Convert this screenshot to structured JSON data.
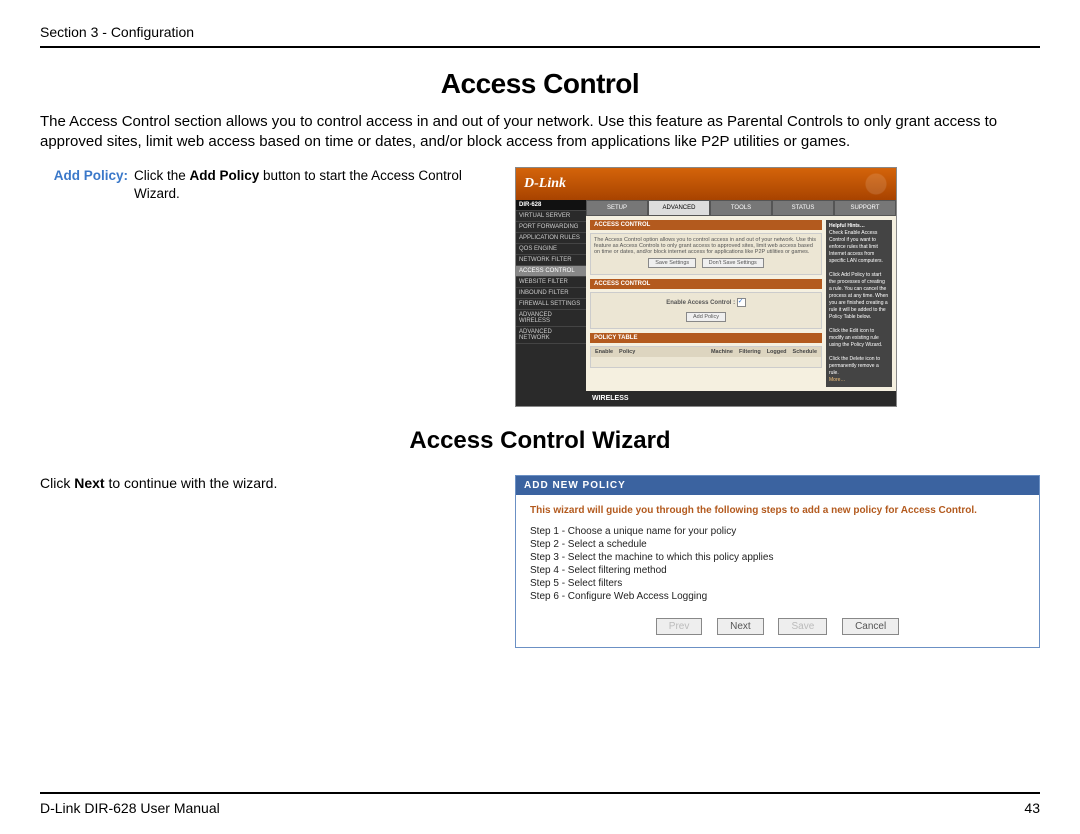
{
  "header": "Section 3 - Configuration",
  "title": "Access Control",
  "intro": "The Access Control section allows you to control access in and out of your network. Use this feature as Parental Controls to only grant access to approved sites, limit web access based on time or dates, and/or block access from applications like P2P utilities or games.",
  "feature": {
    "label": "Add Policy:",
    "text_before": "Click the ",
    "text_bold": "Add Policy",
    "text_after": " button to start the Access Control Wizard."
  },
  "screenshot1": {
    "brand": "D-Link",
    "model": "DIR-628",
    "tabs": [
      "SETUP",
      "ADVANCED",
      "TOOLS",
      "STATUS",
      "SUPPORT"
    ],
    "active_tab": 1,
    "sidebar": [
      "VIRTUAL SERVER",
      "PORT FORWARDING",
      "APPLICATION RULES",
      "QOS ENGINE",
      "NETWORK FILTER",
      "ACCESS CONTROL",
      "WEBSITE FILTER",
      "INBOUND FILTER",
      "FIREWALL SETTINGS",
      "ADVANCED WIRELESS",
      "ADVANCED NETWORK"
    ],
    "active_sidebar": 5,
    "section_title": "ACCESS CONTROL",
    "section_desc": "The Access Control option allows you to control access in and out of your network. Use this feature as Access Controls to only grant access to approved sites, limit web access based on time or dates, and/or block internet access for applications like P2P utilities or games.",
    "save_btn": "Save Settings",
    "dont_save_btn": "Don't Save Settings",
    "enable_label": "Enable Access Control :",
    "add_policy_btn": "Add Policy",
    "policy_table_title": "POLICY TABLE",
    "policy_cols": [
      "Enable",
      "Policy",
      "Machine",
      "Filtering",
      "Logged",
      "Schedule"
    ],
    "help_title": "Helpful Hints…",
    "help_text": "Check Enable Access Control if you want to enforce rules that limit Internet access from specific LAN computers.\n\nClick Add Policy to start the processes of creating a rule. You can cancel the process at any time. When you are finished creating a rule it will be added to the Policy Table below.\n\nClick the Edit icon to modify an existing rule using the Policy Wizard.\n\nClick the Delete icon to permanently remove a rule.",
    "more": "More…",
    "footer": "WIRELESS"
  },
  "subtitle": "Access Control Wizard",
  "wizard_text_before": "Click ",
  "wizard_text_bold": "Next",
  "wizard_text_after": " to continue with the wizard.",
  "screenshot2": {
    "head": "ADD NEW POLICY",
    "intro": "This wizard will guide you through the following steps to add a new policy for Access Control.",
    "steps": [
      "Step 1 - Choose a unique name for your policy",
      "Step 2 - Select a schedule",
      "Step 3 - Select the machine to which this policy applies",
      "Step 4 - Select filtering method",
      "Step 5 - Select filters",
      "Step 6 - Configure Web Access Logging"
    ],
    "buttons": {
      "prev": "Prev",
      "next": "Next",
      "save": "Save",
      "cancel": "Cancel"
    }
  },
  "footer": {
    "left": "D-Link DIR-628 User Manual",
    "right": "43"
  }
}
